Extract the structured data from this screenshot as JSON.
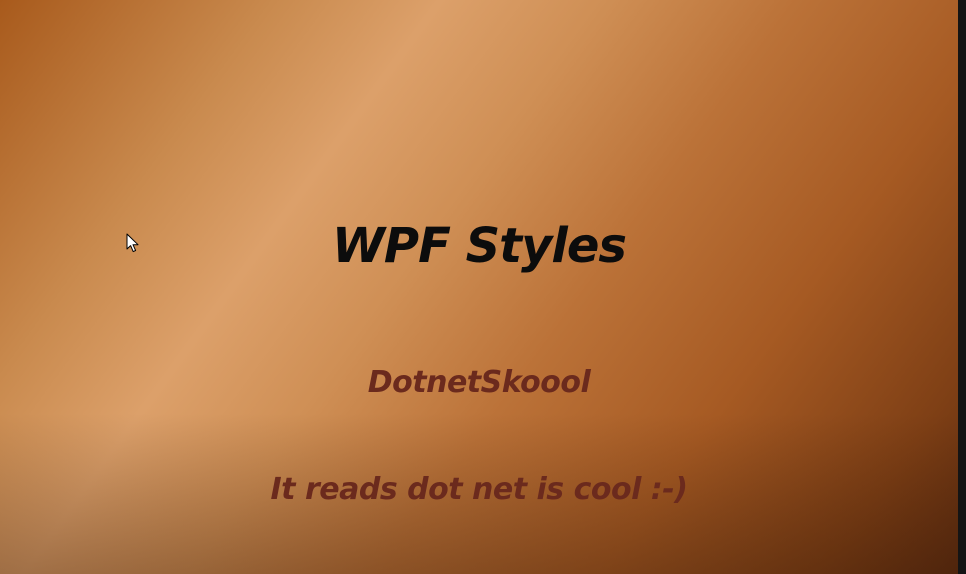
{
  "slide": {
    "title": "WPF Styles",
    "subtitle": "DotnetSkoool",
    "tagline": "It reads dot net is cool :-)"
  },
  "colors": {
    "title_text": "#0c0c0c",
    "subtitle_text": "#6b2a1d",
    "tagline_text": "#6b2a1d",
    "background_light": "#dca06a",
    "background_dark": "#5e2c10"
  },
  "icons": {
    "cursor": "mouse-pointer-icon"
  }
}
